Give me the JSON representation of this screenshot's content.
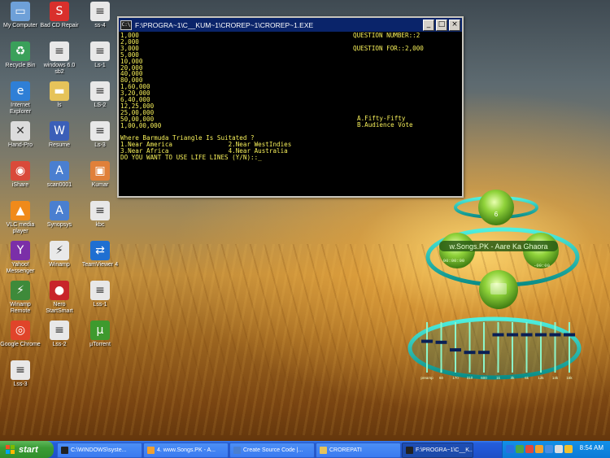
{
  "desktop": {
    "icons": [
      {
        "label": "My Computer",
        "icon": "my-computer-icon",
        "color": "#6ea0d8",
        "glyph": "▭"
      },
      {
        "label": "Bad CD Repair",
        "icon": "bad-cd-repair-icon",
        "color": "#d9302c",
        "glyph": "S"
      },
      {
        "label": "ss-4",
        "icon": "document-icon",
        "color": "#e8e8e8",
        "glyph": "≡"
      },
      {
        "label": "Recycle Bin",
        "icon": "recycle-bin-icon",
        "color": "#3aa05a",
        "glyph": "♻"
      },
      {
        "label": "windows 6.0 sb2",
        "icon": "document-icon",
        "color": "#e8e8e8",
        "glyph": "≡"
      },
      {
        "label": "Ls-1",
        "icon": "document-icon",
        "color": "#e8e8e8",
        "glyph": "≡"
      },
      {
        "label": "Internet Explorer",
        "icon": "internet-explorer-icon",
        "color": "#2f7fd6",
        "glyph": "e"
      },
      {
        "label": "ls",
        "icon": "folder-icon",
        "color": "#e6c35a",
        "glyph": "▬"
      },
      {
        "label": "LS-2",
        "icon": "document-icon",
        "color": "#e8e8e8",
        "glyph": "≡"
      },
      {
        "label": "Hand-Pro",
        "icon": "hand-pro-icon",
        "color": "#dcdcdc",
        "glyph": "✕"
      },
      {
        "label": "Resume",
        "icon": "word-document-icon",
        "color": "#3b5fb8",
        "glyph": "W"
      },
      {
        "label": "Ls-3",
        "icon": "document-icon",
        "color": "#e8e8e8",
        "glyph": "≡"
      },
      {
        "label": "iShare",
        "icon": "ishare-icon",
        "color": "#d94a3a",
        "glyph": "◉"
      },
      {
        "label": "scan0001",
        "icon": "image-file-icon",
        "color": "#4a7fd0",
        "glyph": "A"
      },
      {
        "label": "Kumar",
        "icon": "image-file-icon",
        "color": "#e0803a",
        "glyph": "▣"
      },
      {
        "label": "VLC media player",
        "icon": "vlc-icon",
        "color": "#f08a1a",
        "glyph": "▲"
      },
      {
        "label": "Synopsys",
        "icon": "image-file-icon",
        "color": "#4a7fd0",
        "glyph": "A"
      },
      {
        "label": "kbc",
        "icon": "document-icon",
        "color": "#e8e8e8",
        "glyph": "≡"
      },
      {
        "label": "Yahoo! Messenger",
        "icon": "yahoo-messenger-icon",
        "color": "#7b2fa8",
        "glyph": "Y"
      },
      {
        "label": "Winamp",
        "icon": "winamp-icon",
        "color": "#e9e9e9",
        "glyph": "⚡"
      },
      {
        "label": "TeamViewer 4",
        "icon": "teamviewer-icon",
        "color": "#1f6fd1",
        "glyph": "⇄"
      },
      {
        "label": "Winamp Remote",
        "icon": "winamp-remote-icon",
        "color": "#3e8a3a",
        "glyph": "⚡"
      },
      {
        "label": "Nero StartSmart",
        "icon": "nero-icon",
        "color": "#c8252a",
        "glyph": "●"
      },
      {
        "label": "Lss-1",
        "icon": "document-icon",
        "color": "#e8e8e8",
        "glyph": "≡"
      },
      {
        "label": "Google Chrome",
        "icon": "chrome-icon",
        "color": "#e0442a",
        "glyph": "◎"
      },
      {
        "label": "Lss-2",
        "icon": "document-icon",
        "color": "#e8e8e8",
        "glyph": "≡"
      },
      {
        "label": "µTorrent",
        "icon": "utorrent-icon",
        "color": "#3e9a2e",
        "glyph": "µ"
      },
      {
        "label": "Lss-3",
        "icon": "document-icon",
        "color": "#e8e8e8",
        "glyph": "≡"
      }
    ]
  },
  "console": {
    "title": "F:\\PROGRA~1\\C__KUM~1\\CROREP~1\\CROREP~1.EXE",
    "icon_text": "C:\\",
    "prize_levels": [
      "1,000",
      "2,000",
      "3,000",
      "5,000",
      "10,000",
      "20,000",
      "40,000",
      "80,000",
      "1,60,000",
      "3,20,000",
      "6,40,000",
      "12,25,000",
      "25,00,000",
      "50,00,000",
      "1,00,00,000"
    ],
    "question_number": "QUESTION NUMBER::2",
    "question_for": "QUESTION FOR::2,000",
    "lifelines": [
      "A.Fifty-Fifty",
      "B.Audience Vote"
    ],
    "question": "Where Barmuda Triangle Is Suitated ?",
    "option_row1": "1.Near America               2.Near WestIndies",
    "option_row2": "3.Near Africa                4.Near Australia",
    "prompt": "DO YOU WANT TO USE LIFE LINES (Y/N)::_",
    "minimize": "_",
    "maximize": "□",
    "close": "×"
  },
  "widget": {
    "track": "w.Songs.PK - Aare Ka Ghaora",
    "top_button": "6",
    "left_readout": "00:00:00",
    "right_readout": "-00:00",
    "eq_bands": [
      "preamp",
      "60",
      "170",
      "310",
      "600",
      "1k",
      "3k",
      "6k",
      "12k",
      "14k",
      "16k"
    ],
    "eq_levels": [
      0.62,
      0.6,
      0.45,
      0.4,
      0.4,
      0.75,
      0.75,
      0.75,
      0.75,
      0.75,
      0.75
    ]
  },
  "taskbar": {
    "start_label": "start",
    "buttons": [
      {
        "label": "C:\\WINDOWS\\syste...",
        "icon_color": "#222222",
        "active": false
      },
      {
        "label": "4. www.Songs.PK - A...",
        "icon_color": "#f0a030",
        "active": false
      },
      {
        "label": "Create Source Code |...",
        "icon_color": "#4a7fd0",
        "active": false
      },
      {
        "label": "CROREPATI",
        "icon_color": "#e6c35a",
        "active": false
      },
      {
        "label": "F:\\PROGRA~1\\C__K...",
        "icon_color": "#222222",
        "active": true
      }
    ],
    "clock": "8:54 AM",
    "tray_icons": [
      "bluetooth-icon",
      "network-icon",
      "shield-icon",
      "antivirus-icon",
      "messenger-icon",
      "volume-icon",
      "update-icon"
    ]
  }
}
